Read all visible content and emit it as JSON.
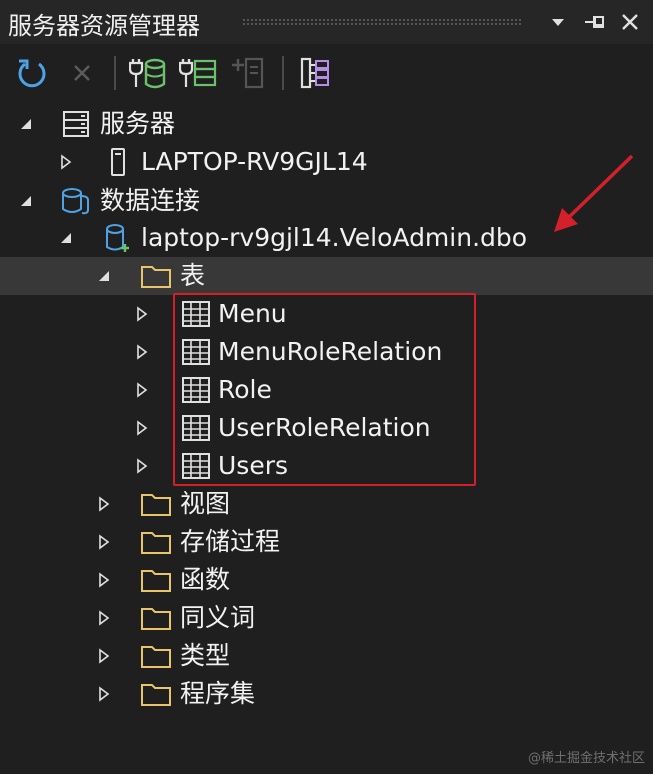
{
  "window": {
    "title": "服务器资源管理器"
  },
  "titlebar_icons": [
    "chevron-down-icon",
    "pin-icon",
    "close-icon"
  ],
  "toolbar": {
    "buttons": [
      "refresh",
      "stop",
      "connect-to-database",
      "connect-to-server",
      "connect-to-sharepoint",
      "show-hierarchy"
    ]
  },
  "tree": {
    "servers": {
      "label": "服务器",
      "expanded": true
    },
    "laptop": {
      "label": "LAPTOP-RV9GJL14",
      "expanded": false
    },
    "data_connections": {
      "label": "数据连接",
      "expanded": true
    },
    "connection": {
      "label": "laptop-rv9gjl14.VeloAdmin.dbo",
      "expanded": true
    },
    "tables_folder": {
      "label": "表",
      "expanded": true
    },
    "tables": [
      {
        "label": "Menu"
      },
      {
        "label": "MenuRoleRelation"
      },
      {
        "label": "Role"
      },
      {
        "label": "UserRoleRelation"
      },
      {
        "label": "Users"
      }
    ],
    "folders": [
      {
        "label": "视图"
      },
      {
        "label": "存储过程"
      },
      {
        "label": "函数"
      },
      {
        "label": "同义词"
      },
      {
        "label": "类型"
      },
      {
        "label": "程序集"
      }
    ]
  },
  "colors": {
    "background": "#1f1f1f",
    "selected_row": "#383838",
    "accent_blue": "#4da3e8",
    "accent_green": "#6bc26b",
    "folder_outline": "#e8c46a",
    "annotation_red": "#d4202a"
  },
  "watermark": "@稀土掘金技术社区"
}
